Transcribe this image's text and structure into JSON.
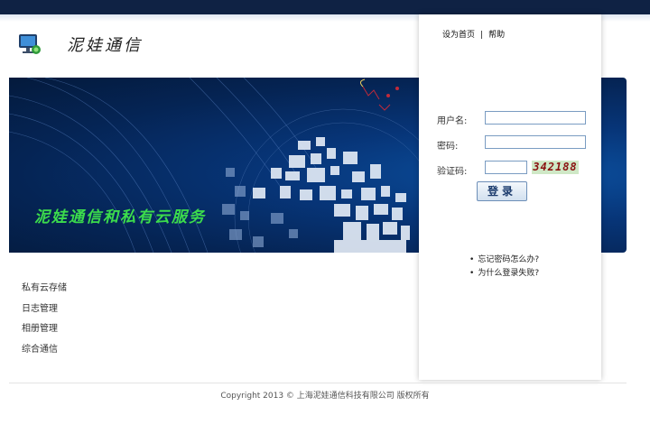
{
  "header": {
    "site_name": "泥娃通信",
    "links": {
      "set_home": "设为首页",
      "separator": "|",
      "help": "帮助"
    }
  },
  "banner": {
    "slogan": "泥娃通信和私有云服务"
  },
  "login": {
    "username_label": "用户名:",
    "password_label": "密码:",
    "captcha_label": "验证码:",
    "username_value": "",
    "password_value": "",
    "captcha_value": "",
    "captcha_code": "342188",
    "submit_label": "登录"
  },
  "help_links": [
    {
      "label": "忘记密码怎么办?"
    },
    {
      "label": "为什么登录失败?"
    }
  ],
  "menu": {
    "items": [
      {
        "label": "私有云存储"
      },
      {
        "label": "日志管理"
      },
      {
        "label": "相册管理"
      },
      {
        "label": "综合通信"
      }
    ]
  },
  "footer": {
    "copyright": "Copyright 2013 © 上海泥娃通信科技有限公司 版权所有"
  },
  "colors": {
    "topbar": "#0f2244",
    "banner_deep": "#052454",
    "slogan_green": "#3cdc4c",
    "captcha_red": "#8a1010"
  }
}
